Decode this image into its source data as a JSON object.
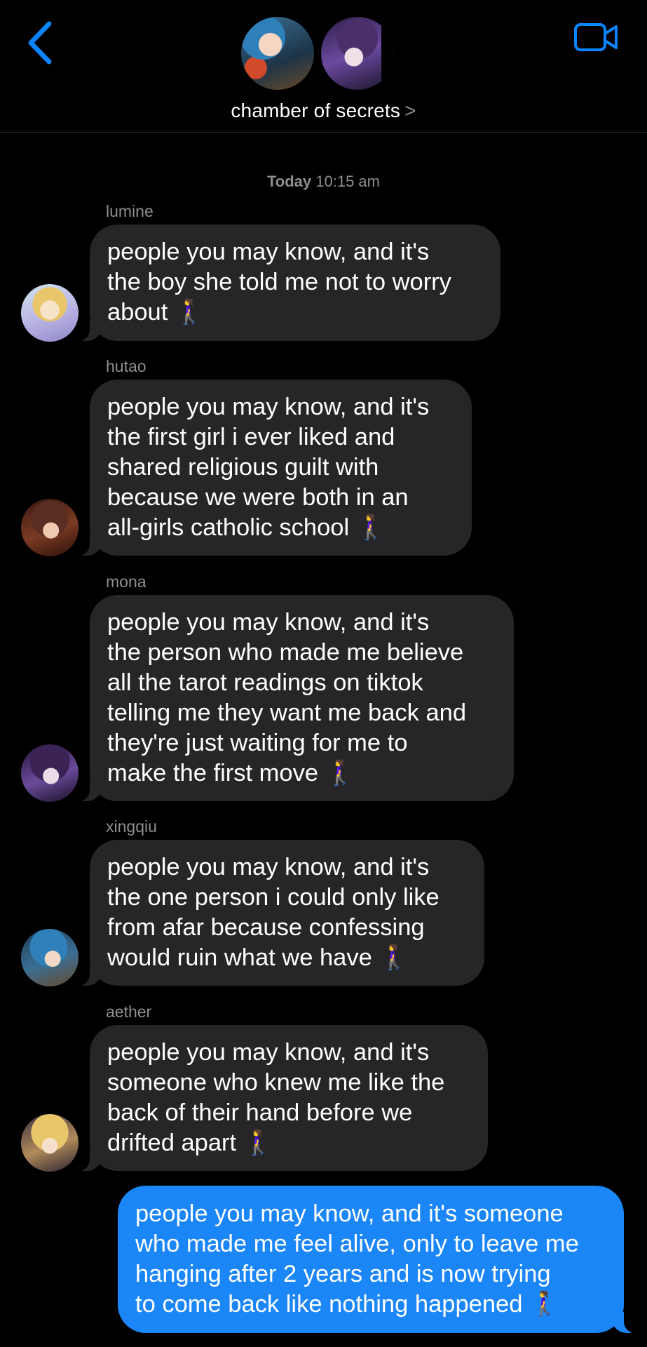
{
  "header": {
    "group_name": "chamber of secrets",
    "chevron": ">",
    "back_icon": "chevron-left-icon",
    "video_icon": "video-camera-icon",
    "accent": "#0a84ff"
  },
  "timestamp": {
    "day": "Today",
    "time": "10:15 am"
  },
  "messages": [
    {
      "sender": "lumine",
      "lines": [
        "people you may know, and it's",
        "the boy she told me not to worry",
        "about 🚶‍♀️"
      ]
    },
    {
      "sender": "hutao",
      "lines": [
        "people you may know, and it's",
        "the first girl i ever liked and",
        "shared religious guilt with",
        "because we were both in an",
        "all-girls catholic school 🚶‍♀️"
      ]
    },
    {
      "sender": "mona",
      "lines": [
        "people you may know, and it's",
        "the person who made me believe",
        "all the tarot readings on tiktok",
        "telling me they want me back and",
        "they're just waiting for me to",
        "make the first move 🚶‍♀️"
      ]
    },
    {
      "sender": "xingqiu",
      "lines": [
        "people you may know, and it's",
        "the one person i could only like",
        "from afar because confessing",
        "would ruin what we have 🚶‍♀️"
      ]
    },
    {
      "sender": "aether",
      "lines": [
        "people you may know, and it's",
        "someone who knew me like the",
        "back of their hand before we",
        "drifted apart 🚶‍♀️"
      ]
    }
  ],
  "outgoing": {
    "lines": [
      "people you may know, and it's someone",
      "who made me feel alive, only to leave me",
      "hanging after 2 years and is now trying",
      "to come back like nothing happened 🚶‍♀️"
    ],
    "color": "#1b86f8"
  },
  "colors": {
    "background": "#000000",
    "incoming_bubble": "#262628",
    "secondary_text": "#8e8e93"
  }
}
